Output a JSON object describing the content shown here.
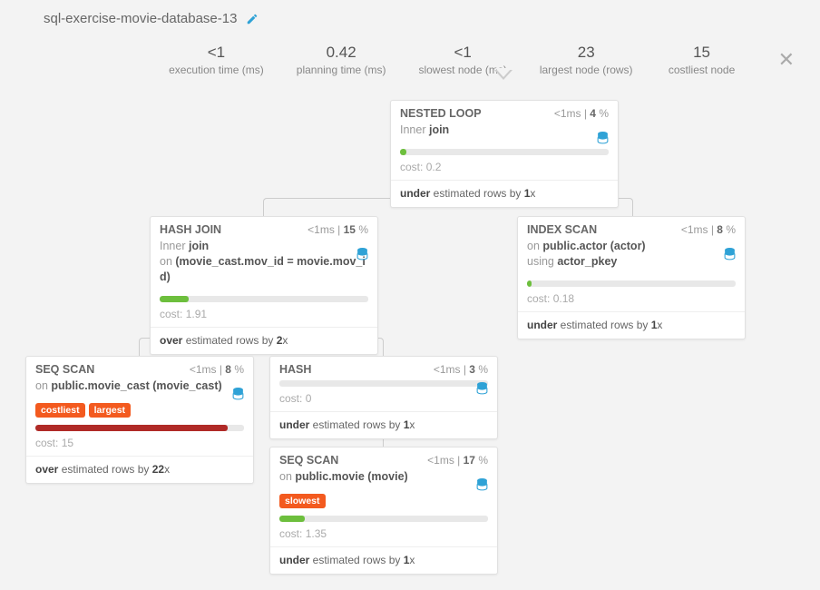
{
  "title": "sql-exercise-movie-database-13",
  "stats": {
    "exec_time": {
      "val": "<1",
      "label": "execution time (ms)"
    },
    "plan_time": {
      "val": "0.42",
      "label": "planning time (ms)"
    },
    "slowest": {
      "val": "<1",
      "label": "slowest node (ms)"
    },
    "largest": {
      "val": "23",
      "label": "largest node (rows)"
    },
    "costliest": {
      "val": "15",
      "label": "costliest node"
    }
  },
  "nodes": {
    "n1": {
      "name": "NESTED LOOP",
      "time_pre": "<1",
      "time_unit": "ms",
      "pct": "4",
      "sub_plain": "Inner ",
      "sub_bold": "join",
      "cost_lbl": "cost: ",
      "cost": "0.2",
      "est_pre": "under",
      "est_mid": " estimated rows by ",
      "est_mult": "1",
      "est_x": "x",
      "bar_w": "3%",
      "bar_color": "#6dbf3d"
    },
    "n2": {
      "name": "HASH JOIN",
      "time_pre": "<1",
      "time_unit": "ms",
      "pct": "15",
      "sub_line1_plain": "Inner ",
      "sub_line1_bold": "join",
      "sub_line2_plain": "on ",
      "sub_line2_bold": "(movie_cast.mov_id = movie.mov_id)",
      "cost_lbl": "cost: ",
      "cost": "1.91",
      "est_pre": "over",
      "est_mid": " estimated rows by ",
      "est_mult": "2",
      "est_x": "x",
      "bar_w": "14%",
      "bar_color": "#6dbf3d"
    },
    "n3": {
      "name": "INDEX SCAN",
      "time_pre": "<1",
      "time_unit": "ms",
      "pct": "8",
      "sub_line1_plain": "on ",
      "sub_line1_bold": "public.actor (actor)",
      "sub_line2_plain": "using ",
      "sub_line2_bold": "actor_pkey",
      "cost_lbl": "cost: ",
      "cost": "0.18",
      "est_pre": "under",
      "est_mid": " estimated rows by ",
      "est_mult": "1",
      "est_x": "x",
      "bar_w": "2%",
      "bar_color": "#6dbf3d"
    },
    "n4": {
      "name": "SEQ SCAN",
      "time_pre": "<1",
      "time_unit": "ms",
      "pct": "8",
      "sub_plain": "on ",
      "sub_bold": "public.movie_cast (movie_cast)",
      "badges": [
        "costliest",
        "largest"
      ],
      "cost_lbl": "cost: ",
      "cost": "15",
      "est_pre": "over",
      "est_mid": " estimated rows by ",
      "est_mult": "22",
      "est_x": "x",
      "bar_w": "92%",
      "bar_color": "#b02a27"
    },
    "n5": {
      "name": "HASH",
      "time_pre": "<1",
      "time_unit": "ms",
      "pct": "3",
      "cost_lbl": "cost: ",
      "cost": "0",
      "est_pre": "under",
      "est_mid": " estimated rows by ",
      "est_mult": "1",
      "est_x": "x",
      "bar_w": "0%",
      "bar_color": "#6dbf3d"
    },
    "n6": {
      "name": "SEQ SCAN",
      "time_pre": "<1",
      "time_unit": "ms",
      "pct": "17",
      "sub_plain": "on ",
      "sub_bold": "public.movie (movie)",
      "badges": [
        "slowest"
      ],
      "cost_lbl": "cost: ",
      "cost": "1.35",
      "est_pre": "under",
      "est_mid": " estimated rows by ",
      "est_mult": "1",
      "est_x": "x",
      "bar_w": "12%",
      "bar_color": "#6dbf3d"
    }
  }
}
